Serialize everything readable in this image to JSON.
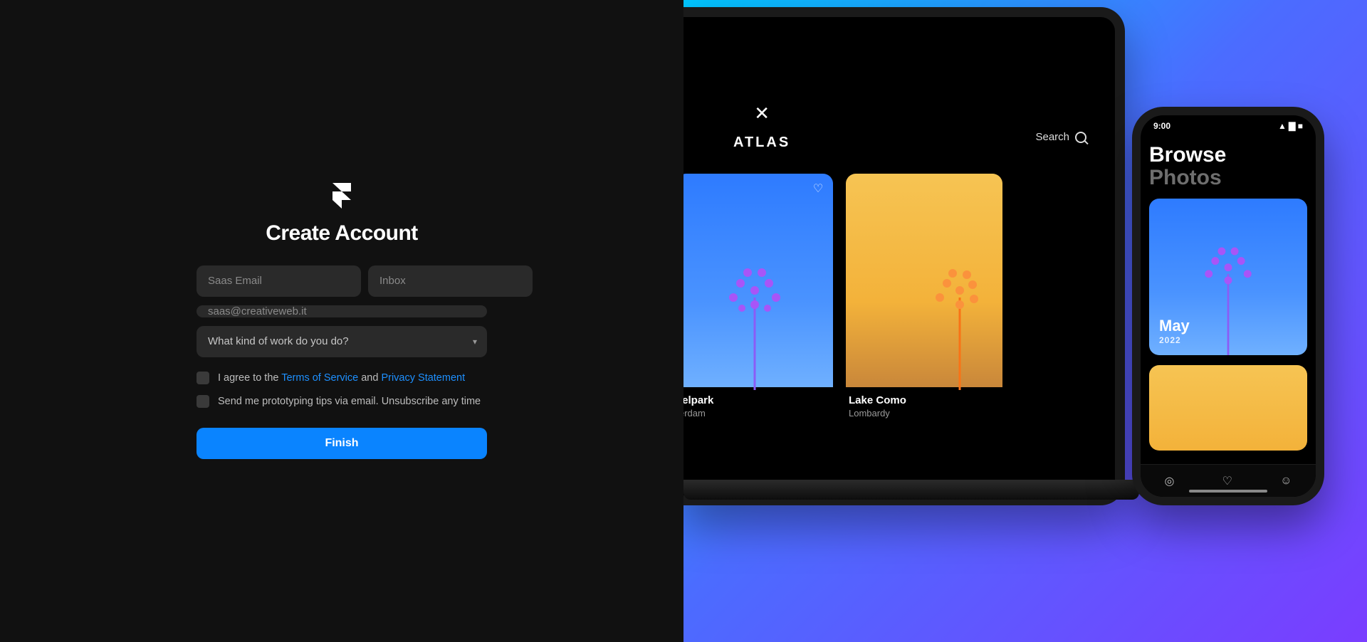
{
  "form": {
    "title": "Create Account",
    "first_name_placeholder": "Saas Email",
    "last_name_placeholder": "Inbox",
    "email_placeholder": "saas@creativeweb.it",
    "work_select_label": "What kind of work do you do?",
    "terms_prefix": "I agree to the ",
    "terms_link": "Terms of Service",
    "terms_middle": " and ",
    "privacy_link": "Privacy Statement",
    "tips_label": "Send me prototyping tips via email. Unsubscribe any time",
    "finish_label": "Finish"
  },
  "preview": {
    "laptop": {
      "brand": "ATLAS",
      "search_label": "Search",
      "cards": [
        {
          "title": "lelpark",
          "subtitle": "erdam"
        },
        {
          "title": "Lake Como",
          "subtitle": "Lombardy"
        }
      ]
    },
    "phone": {
      "time": "9:00",
      "heading": "Browse",
      "subheading": "Photos",
      "card_month": "May",
      "card_year": "2022"
    }
  }
}
